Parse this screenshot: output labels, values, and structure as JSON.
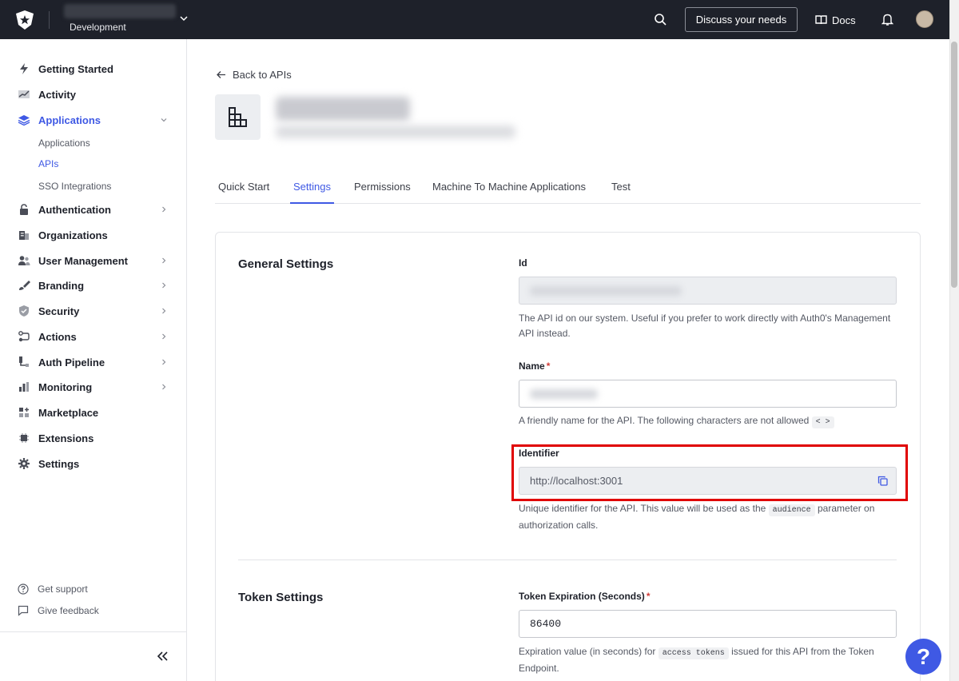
{
  "topbar": {
    "tenant_env": "Development",
    "discuss_label": "Discuss your needs",
    "docs_label": "Docs"
  },
  "sidebar": {
    "items": [
      {
        "label": "Getting Started",
        "icon": "lightning-icon"
      },
      {
        "label": "Activity",
        "icon": "chart-line-icon"
      },
      {
        "label": "Applications",
        "icon": "layers-icon"
      },
      {
        "label": "Authentication",
        "icon": "lock-icon"
      },
      {
        "label": "Organizations",
        "icon": "building-icon"
      },
      {
        "label": "User Management",
        "icon": "users-icon"
      },
      {
        "label": "Branding",
        "icon": "brush-icon"
      },
      {
        "label": "Security",
        "icon": "shield-icon"
      },
      {
        "label": "Actions",
        "icon": "actions-icon"
      },
      {
        "label": "Auth Pipeline",
        "icon": "pipeline-icon"
      },
      {
        "label": "Monitoring",
        "icon": "bar-chart-icon"
      },
      {
        "label": "Marketplace",
        "icon": "grid-plus-icon"
      },
      {
        "label": "Extensions",
        "icon": "chip-icon"
      },
      {
        "label": "Settings",
        "icon": "gear-icon"
      }
    ],
    "subitems": [
      {
        "label": "Applications"
      },
      {
        "label": "APIs"
      },
      {
        "label": "SSO Integrations"
      }
    ],
    "footer": {
      "support": "Get support",
      "feedback": "Give feedback"
    },
    "accent": "#3f59e4"
  },
  "main": {
    "back_label": "Back to APIs",
    "tabs": [
      {
        "label": "Quick Start"
      },
      {
        "label": "Settings"
      },
      {
        "label": "Permissions"
      },
      {
        "label": "Machine To Machine Applications"
      },
      {
        "label": "Test"
      }
    ],
    "general": {
      "title": "General Settings",
      "id_label": "Id",
      "id_help": "The API id on our system. Useful if you prefer to work directly with Auth0's Management API instead.",
      "name_label": "Name",
      "name_required": "*",
      "name_help": "A friendly name for the API. The following characters are not allowed",
      "name_disallowed": "< >",
      "identifier_label": "Identifier",
      "identifier_value": "http://localhost:3001",
      "identifier_help_pre": "Unique identifier for the API. This value will be used as the",
      "identifier_help_code": "audience",
      "identifier_help_post": "parameter on authorization calls."
    },
    "token": {
      "title": "Token Settings",
      "exp_label": "Token Expiration (Seconds)",
      "exp_required": "*",
      "exp_value": "86400",
      "exp_help_pre": "Expiration value (in seconds) for",
      "exp_help_code": "access tokens",
      "exp_help_post": "issued for this API from the Token Endpoint."
    }
  },
  "fab_label": "?"
}
